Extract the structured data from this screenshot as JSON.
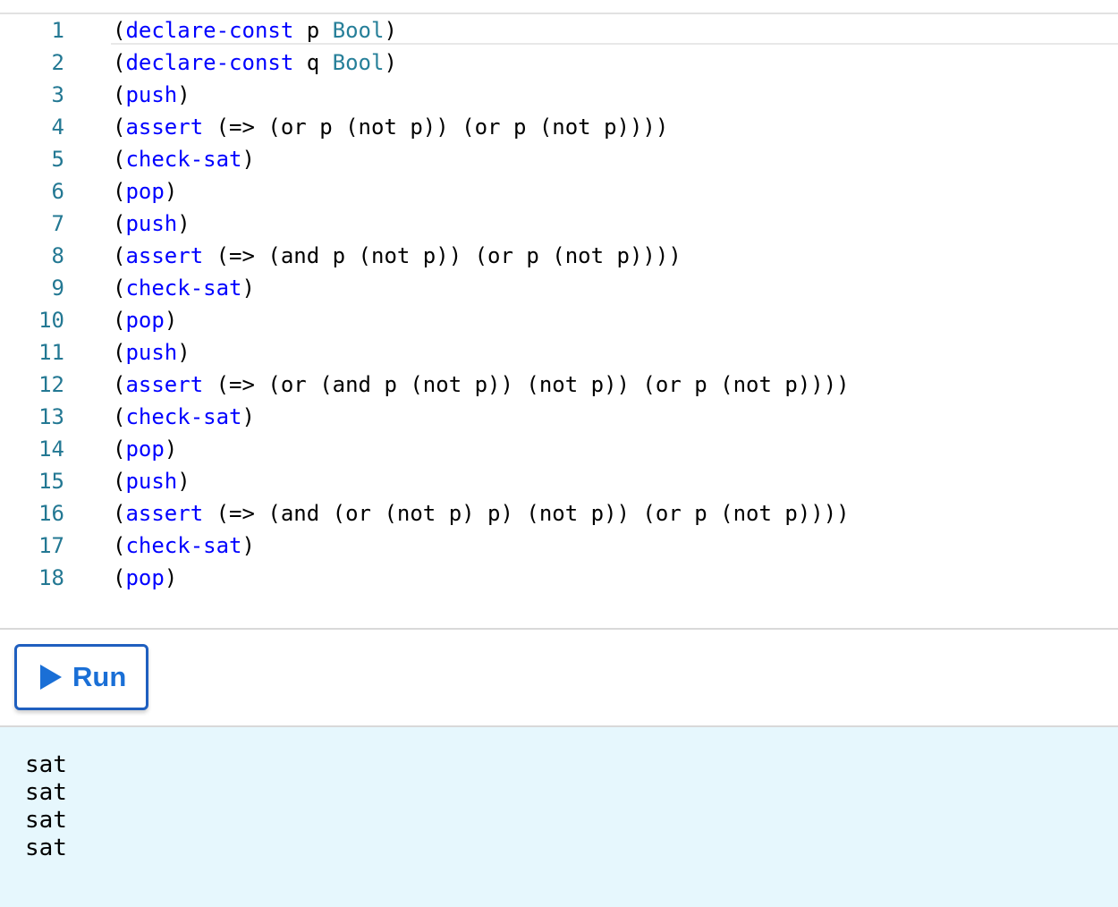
{
  "editor": {
    "lines": [
      {
        "num": "1",
        "tokens": [
          [
            "p",
            "("
          ],
          [
            "k",
            "declare-const"
          ],
          [
            "p",
            " p "
          ],
          [
            "t",
            "Bool"
          ],
          [
            "p",
            ")"
          ]
        ]
      },
      {
        "num": "2",
        "tokens": [
          [
            "p",
            "("
          ],
          [
            "k",
            "declare-const"
          ],
          [
            "p",
            " q "
          ],
          [
            "t",
            "Bool"
          ],
          [
            "p",
            ")"
          ]
        ]
      },
      {
        "num": "3",
        "tokens": [
          [
            "p",
            "("
          ],
          [
            "k",
            "push"
          ],
          [
            "p",
            ")"
          ]
        ]
      },
      {
        "num": "4",
        "tokens": [
          [
            "p",
            "("
          ],
          [
            "k",
            "assert"
          ],
          [
            "p",
            " (=> (or p (not p)) (or p (not p))))"
          ]
        ]
      },
      {
        "num": "5",
        "tokens": [
          [
            "p",
            "("
          ],
          [
            "k",
            "check-sat"
          ],
          [
            "p",
            ")"
          ]
        ]
      },
      {
        "num": "6",
        "tokens": [
          [
            "p",
            "("
          ],
          [
            "k",
            "pop"
          ],
          [
            "p",
            ")"
          ]
        ]
      },
      {
        "num": "7",
        "tokens": [
          [
            "p",
            "("
          ],
          [
            "k",
            "push"
          ],
          [
            "p",
            ")"
          ]
        ]
      },
      {
        "num": "8",
        "tokens": [
          [
            "p",
            "("
          ],
          [
            "k",
            "assert"
          ],
          [
            "p",
            " (=> (and p (not p)) (or p (not p))))"
          ]
        ]
      },
      {
        "num": "9",
        "tokens": [
          [
            "p",
            "("
          ],
          [
            "k",
            "check-sat"
          ],
          [
            "p",
            ")"
          ]
        ]
      },
      {
        "num": "10",
        "tokens": [
          [
            "p",
            "("
          ],
          [
            "k",
            "pop"
          ],
          [
            "p",
            ")"
          ]
        ]
      },
      {
        "num": "11",
        "tokens": [
          [
            "p",
            "("
          ],
          [
            "k",
            "push"
          ],
          [
            "p",
            ")"
          ]
        ]
      },
      {
        "num": "12",
        "tokens": [
          [
            "p",
            "("
          ],
          [
            "k",
            "assert"
          ],
          [
            "p",
            " (=> (or (and p (not p)) (not p)) (or p (not p))))"
          ]
        ]
      },
      {
        "num": "13",
        "tokens": [
          [
            "p",
            "("
          ],
          [
            "k",
            "check-sat"
          ],
          [
            "p",
            ")"
          ]
        ]
      },
      {
        "num": "14",
        "tokens": [
          [
            "p",
            "("
          ],
          [
            "k",
            "pop"
          ],
          [
            "p",
            ")"
          ]
        ]
      },
      {
        "num": "15",
        "tokens": [
          [
            "p",
            "("
          ],
          [
            "k",
            "push"
          ],
          [
            "p",
            ")"
          ]
        ]
      },
      {
        "num": "16",
        "tokens": [
          [
            "p",
            "("
          ],
          [
            "k",
            "assert"
          ],
          [
            "p",
            " (=> (and (or (not p) p) (not p)) (or p (not p))))"
          ]
        ]
      },
      {
        "num": "17",
        "tokens": [
          [
            "p",
            "("
          ],
          [
            "k",
            "check-sat"
          ],
          [
            "p",
            ")"
          ]
        ]
      },
      {
        "num": "18",
        "tokens": [
          [
            "p",
            "("
          ],
          [
            "k",
            "pop"
          ],
          [
            "p",
            ")"
          ]
        ]
      }
    ],
    "colors": {
      "keyword": "#0000ff",
      "type": "#267f99",
      "line_number": "#237893"
    }
  },
  "run_button": {
    "label": "Run",
    "icon": "play-icon",
    "color": "#1a6fd6"
  },
  "output": {
    "lines": [
      "sat",
      "sat",
      "sat",
      "sat"
    ],
    "background": "#e6f7fd"
  }
}
